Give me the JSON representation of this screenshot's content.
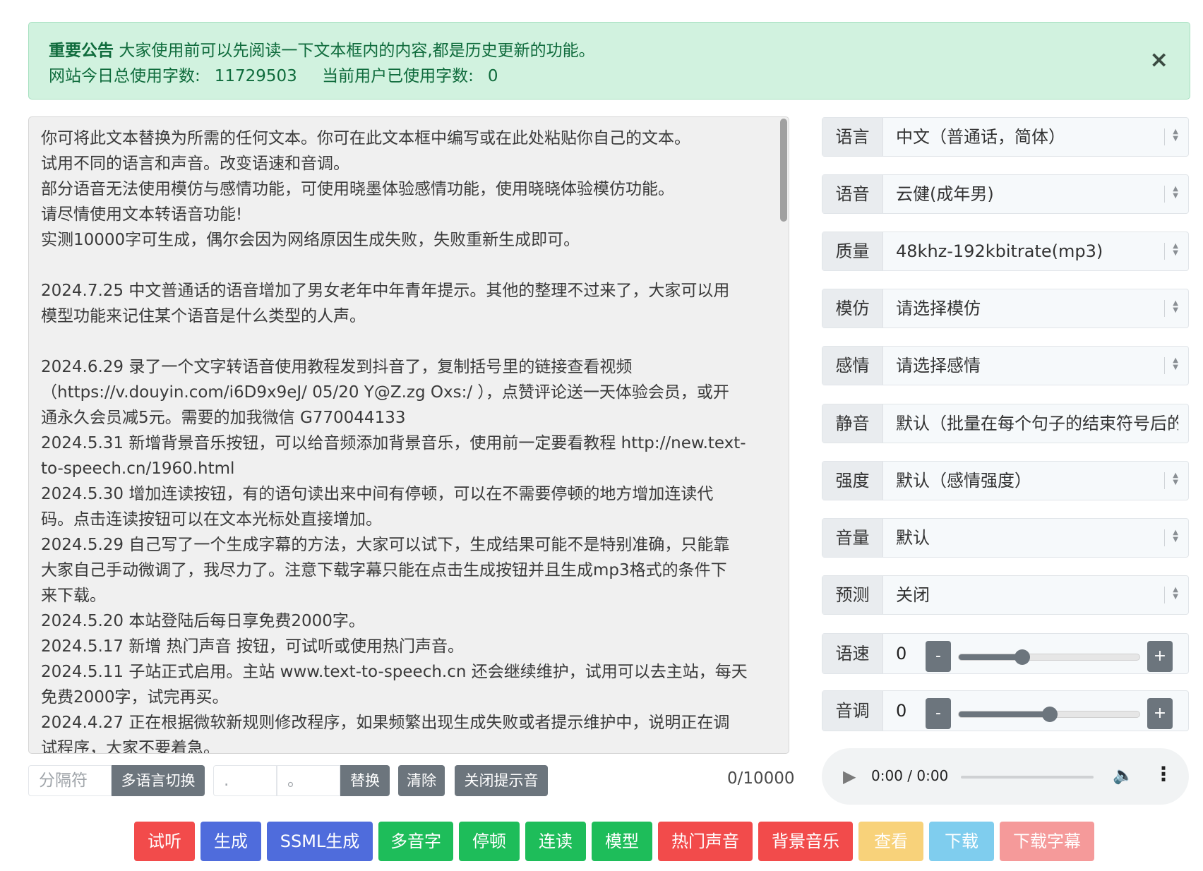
{
  "alert": {
    "title": "重要公告",
    "message": "大家使用前可以先阅读一下文本框内的内容,都是历史更新的功能。",
    "today_label": "网站今日总使用字数:",
    "today_value": "11729503",
    "user_label": "当前用户已使用字数:",
    "user_value": "0",
    "close": "×"
  },
  "editor": {
    "text": "你可将此文本替换为所需的任何文本。你可在此文本框中编写或在此处粘贴你自己的文本。\n试用不同的语言和声音。改变语速和音调。\n部分语音无法使用模仿与感情功能，可使用晓墨体验感情功能，使用晓晓体验模仿功能。\n请尽情使用文本转语音功能!\n实测10000字可生成，偶尔会因为网络原因生成失败，失败重新生成即可。\n\n2024.7.25 中文普通话的语音增加了男女老年中年青年提示。其他的整理不过来了，大家可以用\n模型功能来记住某个语音是什么类型的人声。\n\n2024.6.29 录了一个文字转语音使用教程发到抖音了，复制括号里的链接查看视频\n（https://v.douyin.com/i6D9x9eJ/ 05/20 Y@Z.zg Oxs:/ ），点赞评论送一天体验会员，或开\n通永久会员减5元。需要的加我微信 G770044133\n2024.5.31 新增背景音乐按钮，可以给音频添加背景音乐，使用前一定要看教程 http://new.text-\nto-speech.cn/1960.html\n2024.5.30 增加连读按钮，有的语句读出来中间有停顿，可以在不需要停顿的地方增加连读代\n码。点击连读按钮可以在文本光标处直接增加。\n2024.5.29 自己写了一个生成字幕的方法，大家可以试下，生成结果可能不是特别准确，只能靠\n大家自己手动微调了，我尽力了。注意下载字幕只能在点击生成按钮并且生成mp3格式的条件下\n来下载。\n2024.5.20 本站登陆后每日享免费2000字。\n2024.5.17 新增 热门声音 按钮，可试听或使用热门声音。\n2024.5.11 子站正式启用。主站 www.text-to-speech.cn 还会继续维护，试用可以去主站，每天\n免费2000字，试完再买。\n2024.4.27 正在根据微软新规则修改程序，如果频繁出现生成失败或者提示维护中，说明正在调\n试程序，大家不要着急。"
  },
  "toolbar": {
    "separator_placeholder": "分隔符",
    "multilang_label": "多语言切换",
    "find_value": ".",
    "replace_value": "。",
    "replace_label": "替换",
    "clear_label": "清除",
    "close_tone_label": "关闭提示音",
    "counter": "0/10000"
  },
  "settings": {
    "language": {
      "label": "语言",
      "value": "中文（普通话，简体）"
    },
    "voice": {
      "label": "语音",
      "value": "云健(成年男)"
    },
    "quality": {
      "label": "质量",
      "value": "48khz-192kbitrate(mp3)"
    },
    "imitate": {
      "label": "模仿",
      "value": "请选择模仿"
    },
    "emotion": {
      "label": "感情",
      "value": "请选择感情"
    },
    "silence": {
      "label": "静音",
      "value": "默认（批量在每个句子的结束符号后的"
    },
    "intensity": {
      "label": "强度",
      "value": "默认（感情强度）"
    },
    "volume": {
      "label": "音量",
      "value": "默认"
    },
    "predict": {
      "label": "预测",
      "value": "关闭"
    },
    "rate": {
      "label": "语速",
      "value": "0",
      "level": 0.35,
      "minus": "-",
      "plus": "+"
    },
    "pitch": {
      "label": "音调",
      "value": "0",
      "level": 0.5,
      "minus": "-",
      "plus": "+"
    }
  },
  "player": {
    "time": "0:00 / 0:00",
    "progress": 0
  },
  "actions": [
    {
      "label": "试听",
      "color": "#f24b4b"
    },
    {
      "label": "生成",
      "color": "#4f6cdc"
    },
    {
      "label": "SSML生成",
      "color": "#4f6cdc"
    },
    {
      "label": "多音字",
      "color": "#1ebd5a"
    },
    {
      "label": "停顿",
      "color": "#1ebd5a"
    },
    {
      "label": "连读",
      "color": "#1ebd5a"
    },
    {
      "label": "模型",
      "color": "#1ebd5a"
    },
    {
      "label": "热门声音",
      "color": "#f24b4b"
    },
    {
      "label": "背景音乐",
      "color": "#f24b4b"
    },
    {
      "label": "查看",
      "color": "#f8d27a"
    },
    {
      "label": "下载",
      "color": "#7fcdee"
    },
    {
      "label": "下载字幕",
      "color": "#f59a9a"
    }
  ]
}
